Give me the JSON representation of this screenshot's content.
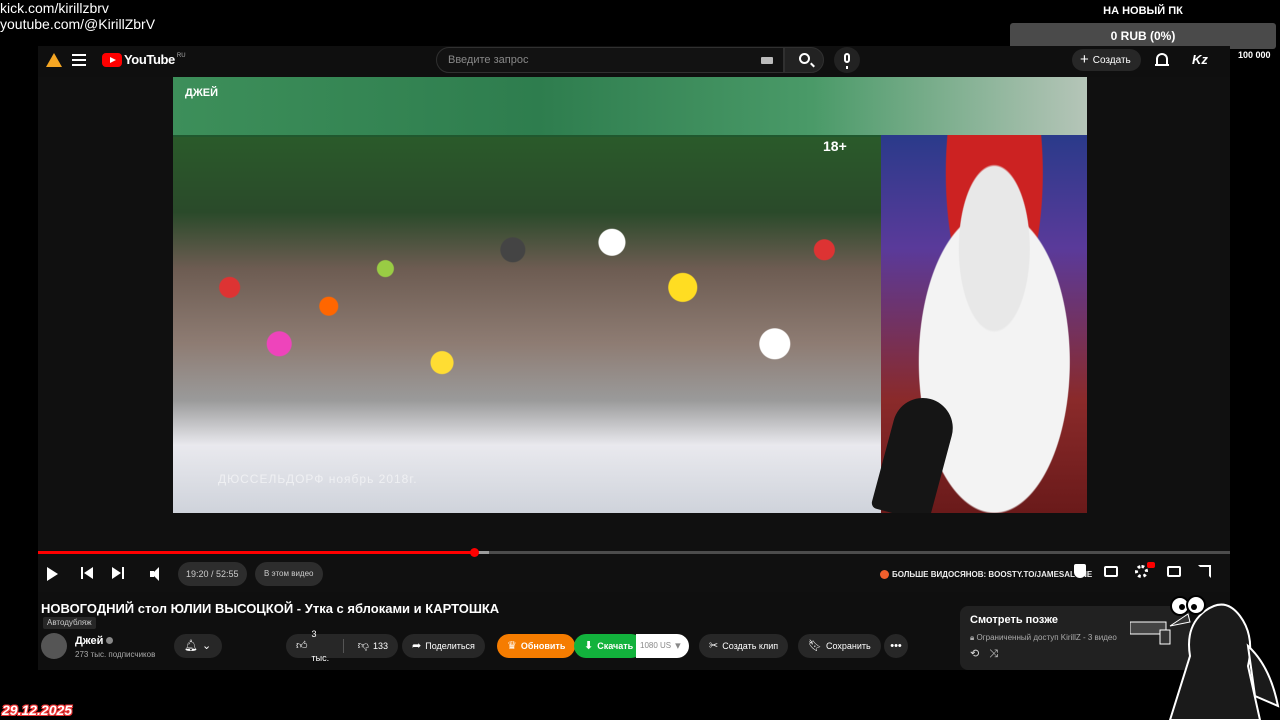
{
  "overlay": {
    "links": [
      "kick.com/kirillzbrv",
      "youtube.com/@KirillZbrV"
    ],
    "goal_title": "НА НОВЫЙ ПК",
    "goal_value": "0 RUB (0%)",
    "goal_min": "0",
    "goal_max": "100 000",
    "goal_progress_fraction": 0.0,
    "date": "29.12.2025"
  },
  "header": {
    "logo_text": "YouTube",
    "country_code": "RU",
    "search_placeholder": "Введите запрос",
    "create_label": "Создать",
    "account_initials": "Kz"
  },
  "video": {
    "channel_tag": "ДЖЕЙ",
    "rating": "18+",
    "caption": "ДЮССЕЛЬДОРФ ноябрь 2018г.",
    "current_time": "19:20 / 52:55",
    "chapter": "В этом видео",
    "boosty_text": "БОЛЬШЕ ВИДОСЯНОВ: BOOSTY.TO/JAMESALONE",
    "progress_fraction": 0.366,
    "buffer_fraction": 0.378
  },
  "details": {
    "title": "НОВОГОДНИЙ стол ЮЛИИ ВЫСОЦКОЙ - Утка с яблоками и КАРТОШКА",
    "dub_label": "Автодубляж",
    "channel_name": "Джей",
    "subscribers": "273 тыс. подписчиков",
    "likes": "3 тыс.",
    "dislikes": "133",
    "share_label": "Поделиться",
    "upgrade_label": "Обновить",
    "download_label": "Скачать",
    "quality_label": "1080 US",
    "clip_label": "Создать клип",
    "save_label": "Сохранить"
  },
  "watch_later": {
    "title": "Смотреть позже",
    "meta": "Ограниченный доступ KirillZ - 3 видео"
  },
  "colors": {
    "progress": "#ff0000",
    "upgrade": "#f57c00",
    "download": "#12b23c"
  }
}
